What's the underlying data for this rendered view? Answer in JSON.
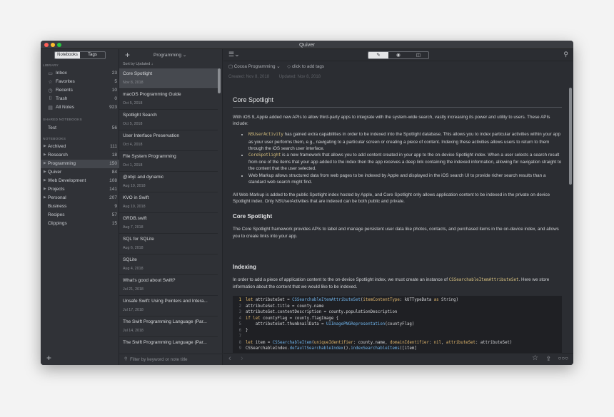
{
  "window": {
    "title": "Quiver"
  },
  "sidebar": {
    "tabs": [
      "Notebooks",
      "Tags"
    ],
    "library_heading": "LIBRARY",
    "library": [
      {
        "icon": "inbox-icon",
        "label": "Inbox",
        "count": "23"
      },
      {
        "icon": "star-icon",
        "label": "Favorites",
        "count": "5"
      },
      {
        "icon": "clock-icon",
        "label": "Recents",
        "count": "10"
      },
      {
        "icon": "trash-icon",
        "label": "Trash",
        "count": "0"
      },
      {
        "icon": "notes-icon",
        "label": "All Notes",
        "count": "923"
      }
    ],
    "shared_heading": "SHARED NOTEBOOKS",
    "shared": [
      {
        "label": "Test",
        "count": "56"
      }
    ],
    "notebooks_heading": "NOTEBOOKS",
    "notebooks": [
      {
        "label": "Archived",
        "count": "111"
      },
      {
        "label": "Research",
        "count": "18"
      },
      {
        "label": "Programming",
        "count": "150"
      },
      {
        "label": "Quiver",
        "count": "84"
      },
      {
        "label": "Web Development",
        "count": "108"
      },
      {
        "label": "Projects",
        "count": "141"
      },
      {
        "label": "Personal",
        "count": "207"
      },
      {
        "label": "Business",
        "count": "9"
      },
      {
        "label": "Recipes",
        "count": "57"
      },
      {
        "label": "Clippings",
        "count": "15"
      }
    ]
  },
  "notelist": {
    "title": "Programming",
    "sort": "Sort by Updated ↓",
    "search_placeholder": "Filter by keyword or note title",
    "notes": [
      {
        "title": "Core Spotlight",
        "date": "Nov 8, 2018"
      },
      {
        "title": "macOS Programming Guide",
        "date": "Oct 5, 2018"
      },
      {
        "title": "Spotlight Search",
        "date": "Oct 5, 2018"
      },
      {
        "title": "User Interface Preservation",
        "date": "Oct 4, 2018"
      },
      {
        "title": "File System Programming",
        "date": "Oct 1, 2018"
      },
      {
        "title": "@objc and dynamic",
        "date": "Aug 19, 2018"
      },
      {
        "title": "KVO in Swift",
        "date": "Aug 19, 2018"
      },
      {
        "title": "GRDB.swift",
        "date": "Aug 7, 2018"
      },
      {
        "title": "SQL for SQLite",
        "date": "Aug 6, 2018"
      },
      {
        "title": "SQLite",
        "date": "Aug 4, 2018"
      },
      {
        "title": "What's good about Swift?",
        "date": "Jul 21, 2018"
      },
      {
        "title": "Unsafe Swift: Using Pointers and Intera...",
        "date": "Jul 17, 2018"
      },
      {
        "title": "The Swift Programming Language (Par...",
        "date": "Jul 14, 2018"
      },
      {
        "title": "The Swift Programming Language (Par...",
        "date": ""
      }
    ]
  },
  "editor": {
    "notebook": "Cocoa Programming",
    "tags_prompt": "click to add tags",
    "created": "Created: Nov 8, 2018",
    "updated": "Updated: Nov 8, 2018",
    "title": "Core Spotlight",
    "intro": "With iOS 9, Apple added new APIs to allow third-party apps to integrate with the system-wide search, vastly increasing its power and utility to users. These APIs include:",
    "bullets": [
      {
        "code": "NSUserActivity",
        "text": " has gained extra capabilities in order to be indexed into the Spotlight database. This allows you to index particular activities within your app as your user performs them, e.g., navigating to a particular screen or creating a piece of content. Indexing these activities allows users to return to them through the iOS search user interface."
      },
      {
        "code": "CoreSpotlight",
        "text": " is a new framework that allows you to add content created in your app to the on-device Spotlight index. When a user selects a search result from one of the items that your app added to the index then the app receives a deep link containing the indexed information, allowing for navigation straight to the content that the user selected."
      },
      {
        "code": "",
        "text": "Web Markup allows structured data from web pages to be indexed by Apple and displayed in the iOS search UI to provide richer search results than a standard web search might find."
      }
    ],
    "para2": "All Web Markup is added to the public Spotlight index hosted by Apple, and Core Spotlight only allows application content to be indexed in the private on-device Spotlight index. Only NSUserActivities that are indexed can be both public and private.",
    "h2a": "Core Spotlight",
    "para3": "The Core Spotlight framework provides APIs to label and manage persistent user data like photos, contacts, and purchased items in the on-device index, and allows you to create links into your app.",
    "h2b": "Indexing",
    "para4_pre": "In order to add a piece of application content to the on-device Spotlight index, we must create an instance of ",
    "para4_code": "CSSearchableItemAttributeSet",
    "para4_post": ". Here we store information about the content that we would like to be indexed.",
    "code_lines": [
      "1",
      "2",
      "3",
      "4",
      "5",
      "6",
      "7",
      "8",
      "9"
    ]
  }
}
